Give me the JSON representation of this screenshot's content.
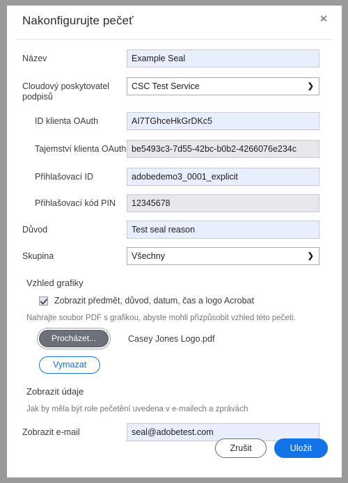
{
  "dialog": {
    "title": "Nakonfigurujte pečeť",
    "close_icon": "close-icon",
    "close_glyph": "✕"
  },
  "colors": {
    "accent": "#1473e6",
    "input_fill": "#e8eefb",
    "backdrop": "#9a9a9a",
    "browse_button": "#6c7079"
  },
  "fields": {
    "name": {
      "label": "Název",
      "value": "Example Seal"
    },
    "provider": {
      "label": "Cloudový poskytovatel podpisů",
      "value": "CSC Test Service",
      "caret": "⌄"
    },
    "oauth_client_id": {
      "label": "ID klienta OAuth",
      "value": "AI7TGhceHkGrDKc5"
    },
    "oauth_client_secret": {
      "label": "Tajemství klienta OAuth",
      "value": "be5493c3-7d55-42bc-b0b2-4266076e234c"
    },
    "login_id": {
      "label": "Přihlašovací ID",
      "value": "adobedemo3_0001_explicit"
    },
    "login_pin": {
      "label": "Přihlašovací kód PIN",
      "value": "12345678"
    },
    "reason": {
      "label": "Důvod",
      "value": "Test seal reason"
    },
    "group": {
      "label": "Skupina",
      "value": "Všechny",
      "caret": "⌄"
    }
  },
  "appearance": {
    "heading": "Vzhled grafiky",
    "checkbox_label": "Zobrazit předmět, důvod, datum, čas a logo Acrobat",
    "checkbox_checked": true,
    "upload_help": "Nahrajte soubor PDF s grafikou, abyste mohli přizpůsobit vzhled této pečeti.",
    "browse_label": "Procházet...",
    "file_name": "Casey Jones Logo.pdf",
    "clear_label": "Vymazat"
  },
  "display": {
    "heading": "Zobrazit údaje",
    "help": "Jak by měla být role pečetění uvedena v e-mailech a zprávách",
    "email_label": "Zobrazit e-mail",
    "email_value": "seal@adobetest.com"
  },
  "footer": {
    "cancel_label": "Zrušit",
    "save_label": "Uložit"
  }
}
